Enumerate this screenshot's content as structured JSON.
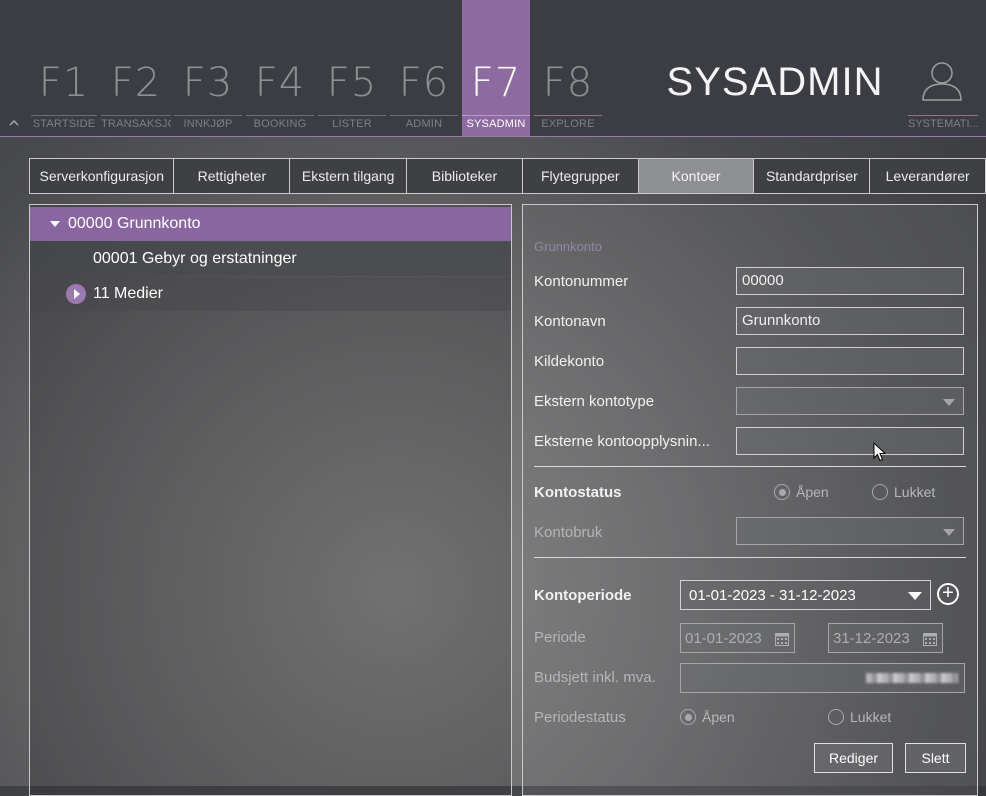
{
  "nav": {
    "keys": [
      {
        "key": "F1",
        "label": "STARTSIDE"
      },
      {
        "key": "F2",
        "label": "TRANSAKSJON"
      },
      {
        "key": "F3",
        "label": "INNKJØP"
      },
      {
        "key": "F4",
        "label": "BOOKING"
      },
      {
        "key": "F5",
        "label": "LISTER"
      },
      {
        "key": "F6",
        "label": "ADMIN"
      },
      {
        "key": "F7",
        "label": "SYSADMIN"
      },
      {
        "key": "F8",
        "label": "EXPLORE"
      }
    ],
    "active_key": "F7",
    "module_title": "SYSADMIN",
    "user_label": "SYSTEMATI...",
    "accent_color": "#8d6a9f"
  },
  "tabs": [
    "Serverkonfigurasjon",
    "Rettigheter",
    "Ekstern tilgang",
    "Biblioteker",
    "Flytegrupper",
    "Kontoer",
    "Standardpriser",
    "Leverandører"
  ],
  "active_tab": "Kontoer",
  "tree": {
    "items": [
      {
        "label": "00000 Grunnkonto",
        "state": "expanded",
        "selected": true
      },
      {
        "label": "00001 Gebyr og erstatninger",
        "state": "leaf"
      },
      {
        "label": "11 Medier",
        "state": "collapsed"
      }
    ]
  },
  "form": {
    "section_title": "Grunnkonto",
    "account_number_label": "Kontonummer",
    "account_number_value": "00000",
    "account_name_label": "Kontonavn",
    "account_name_value": "Grunnkonto",
    "source_account_label": "Kildekonto",
    "source_account_value": "",
    "external_type_label": "Ekstern kontotype",
    "external_type_value": "",
    "external_info_label": "Eksterne kontoopplysnin...",
    "external_info_value": "",
    "status_label": "Kontostatus",
    "status_open_label": "Åpen",
    "status_closed_label": "Lukket",
    "status_selected": "open",
    "usage_label": "Kontobruk",
    "usage_value": "",
    "period_label": "Kontoperiode",
    "period_value": "01-01-2023 - 31-12-2023",
    "add_period_symbol": "+",
    "range_label": "Periode",
    "range_from": "01-01-2023",
    "range_to": "31-12-2023",
    "budget_label": "Budsjett inkl. mva.",
    "period_status_label": "Periodestatus",
    "period_status_open": "Åpen",
    "period_status_closed": "Lukket",
    "edit_button": "Rediger",
    "delete_button": "Slett"
  }
}
